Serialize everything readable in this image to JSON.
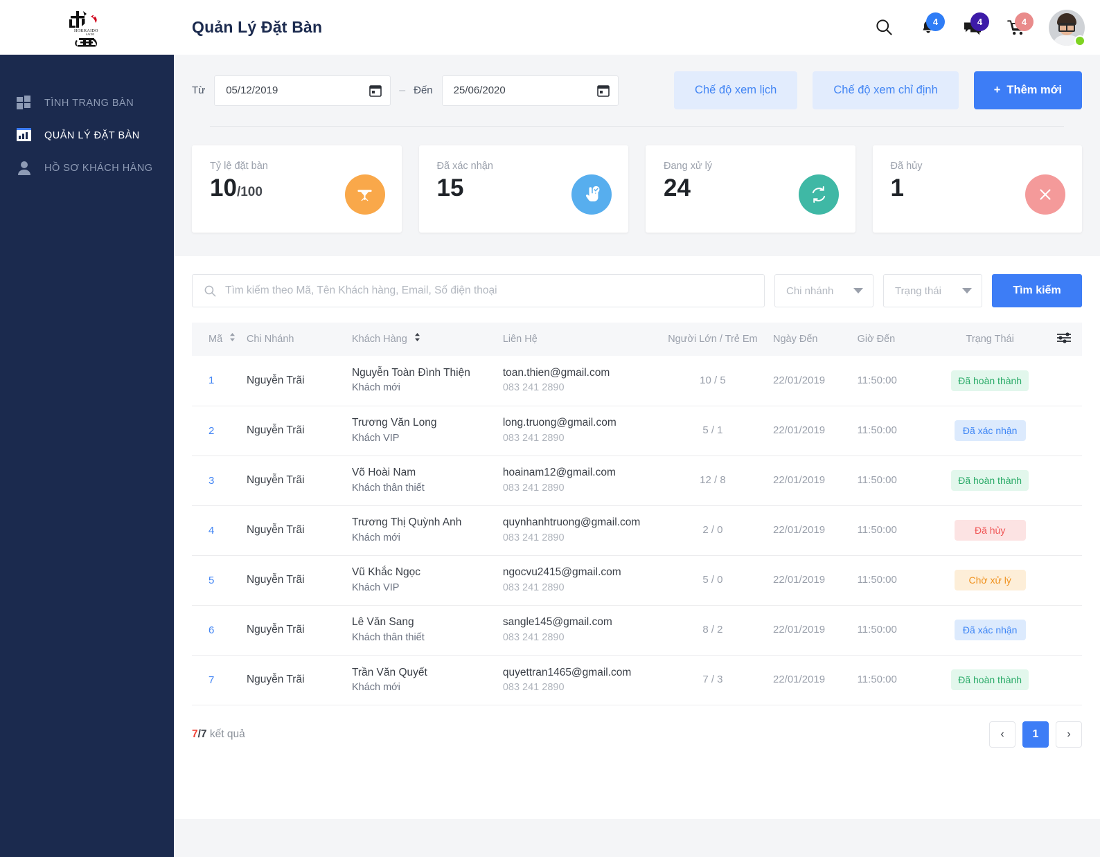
{
  "header": {
    "title": "Quản Lý Đặt Bàn",
    "logo_alt": "Hokkaido Sachi",
    "icons": [
      {
        "name": "search-icon",
        "badge": null
      },
      {
        "name": "bell-icon",
        "badge": "4",
        "badge_color": "#2f7df6"
      },
      {
        "name": "chat-icon",
        "badge": "4",
        "badge_color": "#3d1ba8"
      },
      {
        "name": "cart-icon",
        "badge": "4",
        "badge_color": "#e98b8b"
      }
    ],
    "avatar_status": "online"
  },
  "sidebar": {
    "items": [
      {
        "label": "TÌNH TRẠNG BÀN",
        "icon": "grid-icon",
        "active": false
      },
      {
        "label": "QUẢN LÝ ĐẶT BÀN",
        "icon": "chart-bar-icon",
        "active": true
      },
      {
        "label": "HỒ SƠ KHÁCH HÀNG",
        "icon": "user-icon",
        "active": false
      }
    ]
  },
  "filters": {
    "from_label": "Từ",
    "from_value": "05/12/2019",
    "separator": "–",
    "to_label": "Đến",
    "to_value": "25/06/2020",
    "calendar_view_button": "Chế độ xem lịch",
    "assign_view_button": "Chế độ xem chỉ định",
    "add_button": "Thêm mới",
    "add_button_prefix": "+"
  },
  "stats": [
    {
      "title": "Tỷ lệ đặt bàn",
      "value": "10",
      "denominator": "/100",
      "icon": "table-icon",
      "color": "#f9a84a"
    },
    {
      "title": "Đã xác nhận",
      "value": "15",
      "denominator": "",
      "icon": "hand-check-icon",
      "color": "#57aeee"
    },
    {
      "title": "Đang xử lý",
      "value": "24",
      "denominator": "",
      "icon": "refresh-icon",
      "color": "#3fb8a5"
    },
    {
      "title": "Đã hủy",
      "value": "1",
      "denominator": "",
      "icon": "close-icon",
      "color": "#f49a9a"
    }
  ],
  "search": {
    "placeholder": "Tìm kiếm theo Mã, Tên Khách hàng, Email, Số điện thoại",
    "value": "",
    "branch_placeholder": "Chi nhánh",
    "status_placeholder": "Trạng thái",
    "button": "Tìm kiếm"
  },
  "table": {
    "columns": [
      {
        "key": "ma",
        "label": "Mã",
        "sortable": true
      },
      {
        "key": "chi_nhanh",
        "label": "Chi Nhánh",
        "sortable": false
      },
      {
        "key": "khach_hang",
        "label": "Khách Hàng",
        "sortable": true
      },
      {
        "key": "lien_he",
        "label": "Liên Hệ",
        "sortable": false
      },
      {
        "key": "nguoi",
        "label": "Người Lớn / Trẻ Em",
        "sortable": false
      },
      {
        "key": "ngay_den",
        "label": "Ngày Đến",
        "sortable": false
      },
      {
        "key": "gio_den",
        "label": "Giờ Đến",
        "sortable": false
      },
      {
        "key": "trang_thai",
        "label": "Trạng Thái",
        "sortable": false
      },
      {
        "key": "cfg",
        "label": "",
        "icon": "sliders-icon",
        "sortable": false
      }
    ],
    "rows": [
      {
        "ma": "1",
        "chi_nhanh": "Nguyễn Trãi",
        "ten": "Nguyễn Toàn Đình Thiện",
        "loai": "Khách mới",
        "email": "toan.thien@gmail.com",
        "phone": "083 241 2890",
        "nguoi": "10 / 5",
        "ngay_den": "22/01/2019",
        "gio_den": "11:50:00",
        "trang_thai": "Đã hoàn thành",
        "status_class": "done"
      },
      {
        "ma": "2",
        "chi_nhanh": "Nguyễn Trãi",
        "ten": "Trương Văn Long",
        "loai": "Khách VIP",
        "email": "long.truong@gmail.com",
        "phone": "083 241 2890",
        "nguoi": "5 / 1",
        "ngay_den": "22/01/2019",
        "gio_den": "11:50:00",
        "trang_thai": "Đã xác nhận",
        "status_class": "confirmed"
      },
      {
        "ma": "3",
        "chi_nhanh": "Nguyễn Trãi",
        "ten": "Võ Hoài Nam",
        "loai": "Khách thân thiết",
        "email": "hoainam12@gmail.com",
        "phone": "083 241 2890",
        "nguoi": "12 / 8",
        "ngay_den": "22/01/2019",
        "gio_den": "11:50:00",
        "trang_thai": "Đã hoàn thành",
        "status_class": "done"
      },
      {
        "ma": "4",
        "chi_nhanh": "Nguyễn Trãi",
        "ten": "Trương Thị Quỳnh Anh",
        "loai": "Khách mới",
        "email": "quynhanhtruong@gmail.com",
        "phone": "083 241 2890",
        "nguoi": "2 / 0",
        "ngay_den": "22/01/2019",
        "gio_den": "11:50:00",
        "trang_thai": "Đã hủy",
        "status_class": "cancelled"
      },
      {
        "ma": "5",
        "chi_nhanh": "Nguyễn Trãi",
        "ten": "Vũ Khắc Ngọc",
        "loai": "Khách VIP",
        "email": "ngocvu2415@gmail.com",
        "phone": "083 241 2890",
        "nguoi": "5 / 0",
        "ngay_den": "22/01/2019",
        "gio_den": "11:50:00",
        "trang_thai": "Chờ xử lý",
        "status_class": "pending"
      },
      {
        "ma": "6",
        "chi_nhanh": "Nguyễn Trãi",
        "ten": "Lê Văn Sang",
        "loai": "Khách thân thiết",
        "email": "sangle145@gmail.com",
        "phone": "083 241 2890",
        "nguoi": "8 / 2",
        "ngay_den": "22/01/2019",
        "gio_den": "11:50:00",
        "trang_thai": "Đã xác nhận",
        "status_class": "confirmed"
      },
      {
        "ma": "7",
        "chi_nhanh": "Nguyễn Trãi",
        "ten": "Trần Văn Quyết",
        "loai": "Khách mới",
        "email": "quyettran1465@gmail.com",
        "phone": "083 241 2890",
        "nguoi": "7 / 3",
        "ngay_den": "22/01/2019",
        "gio_den": "11:50:00",
        "trang_thai": "Đã hoàn thành",
        "status_class": "done"
      }
    ]
  },
  "footer": {
    "result_current": "7",
    "result_total": "/7",
    "result_suffix": " kết quả",
    "prev_label": "‹",
    "next_label": "›",
    "pages": [
      "1"
    ],
    "current_page": "1"
  },
  "colors": {
    "sidebar_bg": "#1b2a4e",
    "accent": "#3d7df6",
    "accent_soft": "#e2ecfd",
    "page_bg": "#f4f5f7",
    "danger": "#f04438"
  }
}
